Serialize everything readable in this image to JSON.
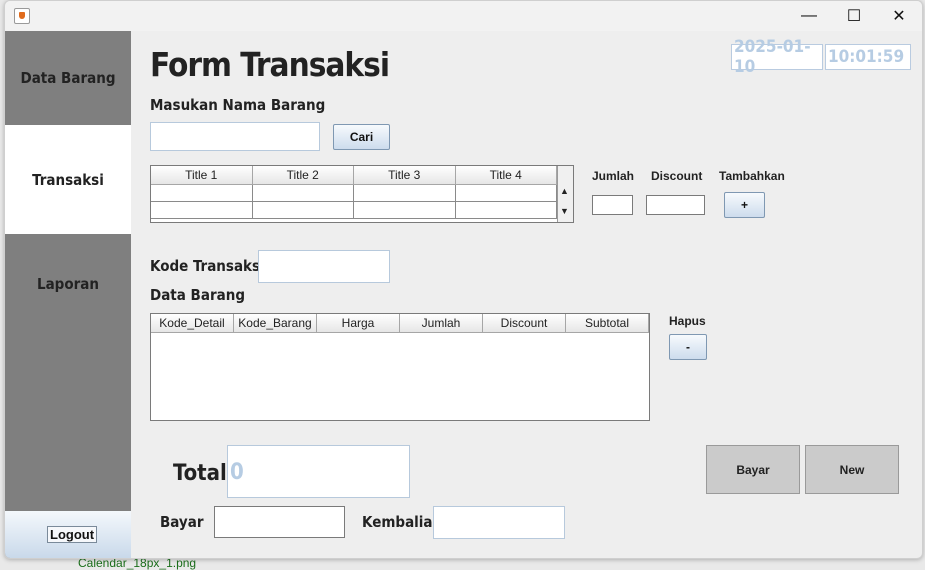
{
  "window": {
    "controls": {
      "minimize": "—",
      "maximize": "☐",
      "close": "✕"
    }
  },
  "sidebar": {
    "items": [
      {
        "label": "Data Barang"
      },
      {
        "label": "Transaksi"
      },
      {
        "label": "Laporan"
      }
    ],
    "logout_label": "Logout"
  },
  "header": {
    "title": "Form Transaksi",
    "date": "2025-01-10",
    "time": "10:01:59"
  },
  "search": {
    "label": "Masukan Nama Barang",
    "value": "",
    "button_label": "Cari"
  },
  "search_table": {
    "columns": [
      "Title 1",
      "Title 2",
      "Title 3",
      "Title 4"
    ]
  },
  "add_item": {
    "jumlah_label": "Jumlah",
    "discount_label": "Discount",
    "tambahkan_label": "Tambahkan",
    "add_button_label": "+"
  },
  "transaction": {
    "kode_label": "Kode Transaksi",
    "kode_value": "",
    "data_barang_label": "Data Barang"
  },
  "detail_table": {
    "columns": [
      "Kode_Detail",
      "Kode_Barang",
      "Harga",
      "Jumlah",
      "Discount",
      "Subtotal"
    ]
  },
  "delete": {
    "label": "Hapus",
    "button_label": "-"
  },
  "summary": {
    "total_label": "Total",
    "total_value": "0",
    "bayar_label": "Bayar",
    "kembalian_label": "Kembalian",
    "bayar_button": "Bayar",
    "new_button": "New"
  },
  "background": {
    "taskbar_text": "Calendar_18px_1.png"
  }
}
